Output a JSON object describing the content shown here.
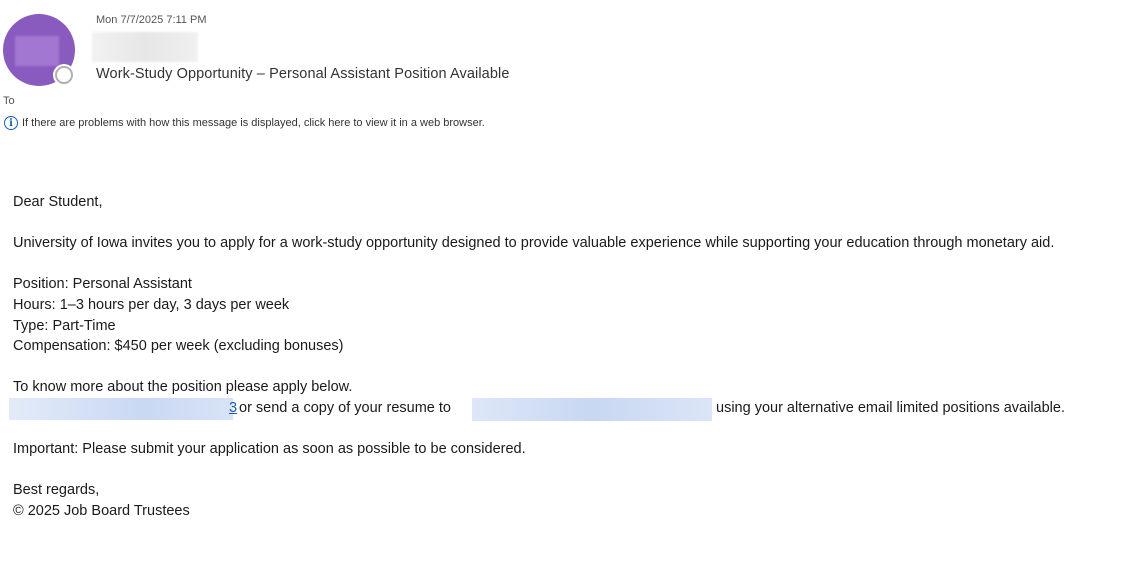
{
  "header": {
    "date": "Mon 7/7/2025 7:11 PM",
    "subject": "Work-Study Opportunity – Personal Assistant Position Available",
    "to_label": "To",
    "info_message": "If there are problems with how this message is displayed, click here to view it in a web browser.",
    "info_icon": "info-icon",
    "avatar_color": "#8a5bbf"
  },
  "body": {
    "greeting": "Dear Student,",
    "intro": "University of Iowa invites you to apply for a work-study opportunity designed to provide valuable experience while supporting your education through monetary aid.",
    "position": "Position: Personal Assistant",
    "hours": "Hours: 1–3 hours per day, 3 days per week",
    "type": "Type: Part-Time",
    "compensation": "Compensation: $450 per week (excluding bonuses)",
    "know_more": "To know more about the position please apply below.",
    "apply_link_tail": "3",
    "apply_line_mid": "or send a copy of your resume to",
    "apply_line_end": "using your alternative email  limited positions available.",
    "important": "Important: Please submit your application as soon as possible to be considered.",
    "signoff": "Best regards,",
    "signature": "© 2025 Job Board Trustees"
  },
  "colors": {
    "link": "#1a5fb4",
    "redaction": "#c9d8f3"
  }
}
